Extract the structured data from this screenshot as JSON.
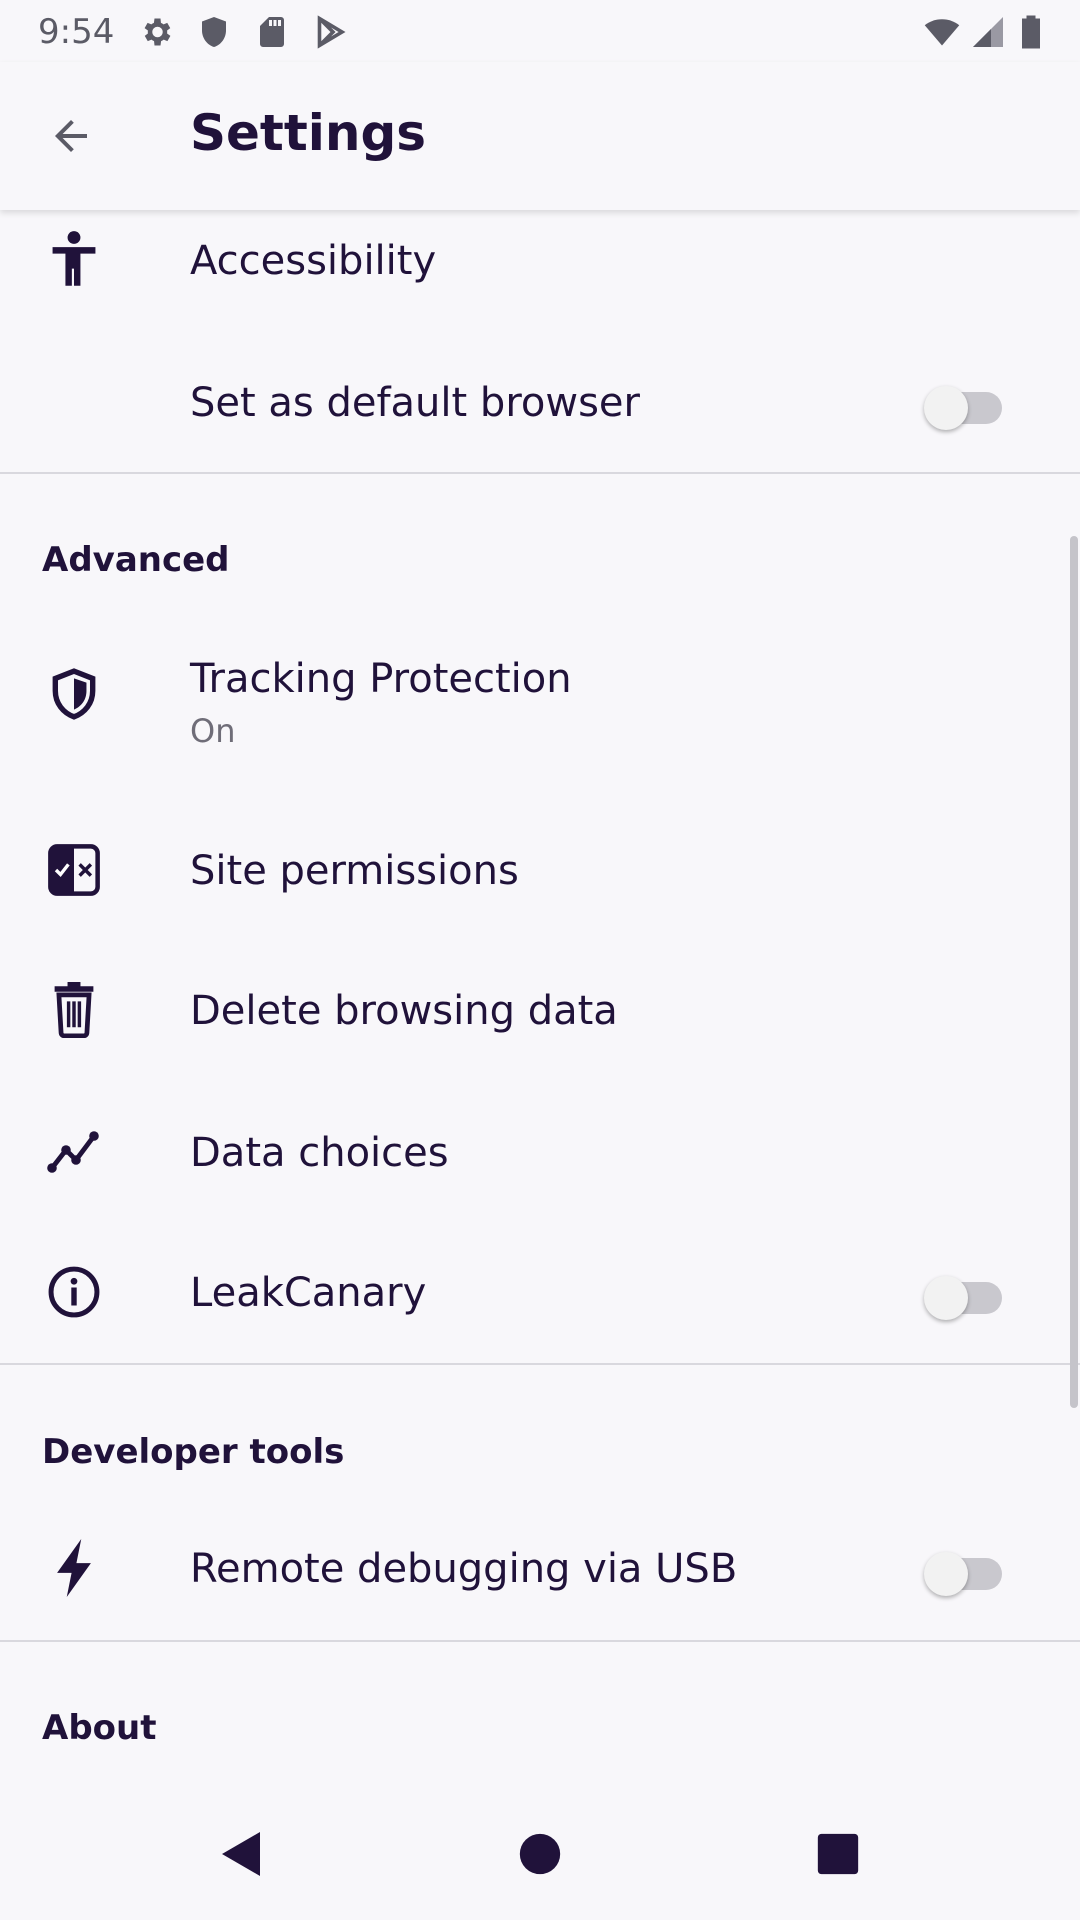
{
  "status_bar": {
    "time": "9:54",
    "left_icons": [
      "gear-icon",
      "shield-icon",
      "sd-card-icon",
      "play-store-icon"
    ],
    "right_icons": [
      "wifi-icon",
      "cell-signal-icon",
      "battery-icon"
    ]
  },
  "app_bar": {
    "title": "Settings",
    "back_icon": "arrow-back-icon"
  },
  "rows": {
    "accessibility": {
      "label": "Accessibility",
      "icon": "accessibility-icon"
    },
    "default_browser": {
      "label": "Set as default browser",
      "enabled": false
    },
    "tracking": {
      "label": "Tracking Protection",
      "sub": "On",
      "icon": "shield-icon"
    },
    "site_permissions": {
      "label": "Site permissions",
      "icon": "permissions-icon"
    },
    "delete_data": {
      "label": "Delete browsing data",
      "icon": "trash-icon"
    },
    "data_choices": {
      "label": "Data choices",
      "icon": "chart-line-icon"
    },
    "leak_canary": {
      "label": "LeakCanary",
      "icon": "info-icon",
      "enabled": false
    },
    "remote_debug": {
      "label": "Remote debugging via USB",
      "icon": "bolt-icon",
      "enabled": false
    }
  },
  "sections": {
    "advanced": "Advanced",
    "developer_tools": "Developer tools",
    "about": "About"
  },
  "nav_bar": {
    "icons": [
      "nav-back-icon",
      "nav-home-icon",
      "nav-recents-icon"
    ]
  },
  "colors": {
    "text": "#20123a",
    "background": "#f8f7fa",
    "subtext": "#6f6d78"
  }
}
